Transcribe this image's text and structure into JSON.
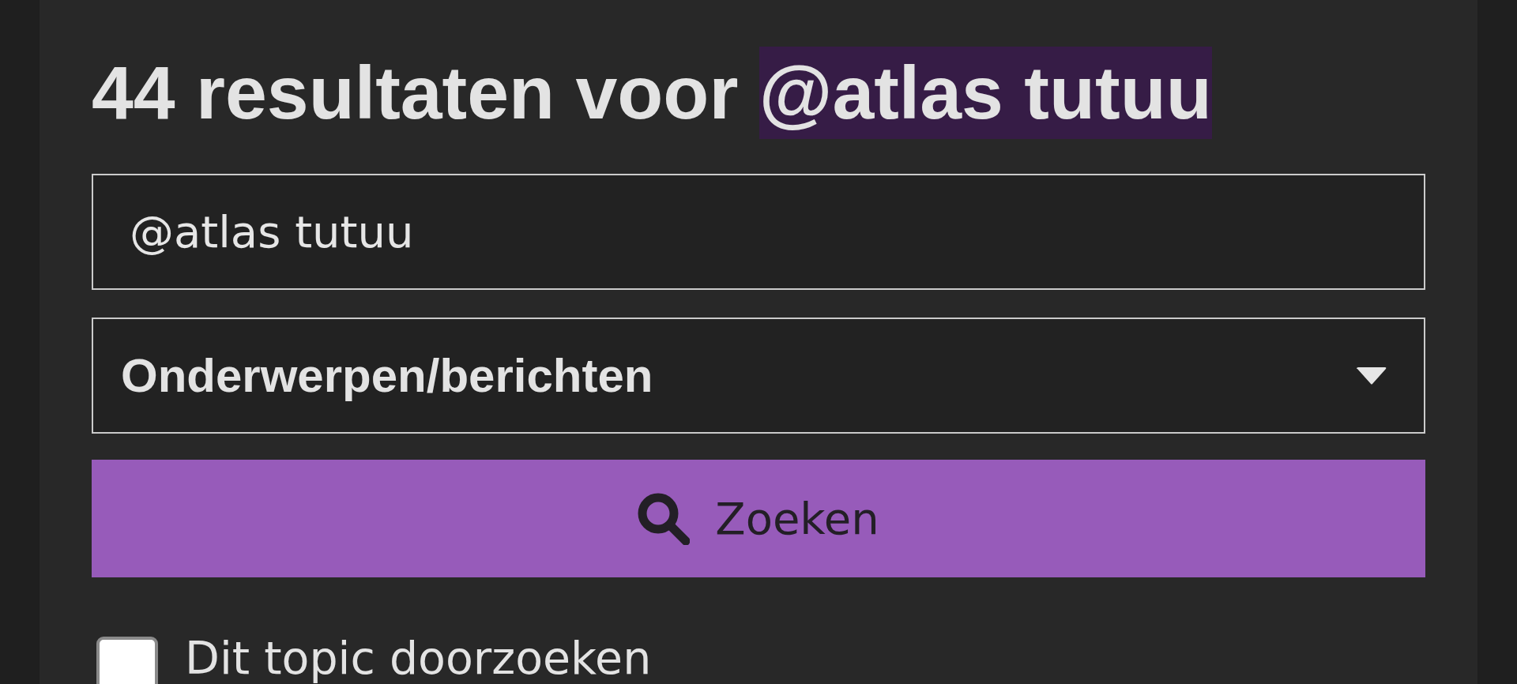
{
  "heading": {
    "text": "44 resultaten voor",
    "query": "@atlas tutuu"
  },
  "search_field": {
    "value": "@atlas tutuu"
  },
  "scope_select": {
    "value": "Onderwerpen/berichten"
  },
  "search_button": {
    "label": "Zoeken"
  },
  "options": [
    {
      "kind": "checkbox",
      "label": "Dit topic doorzoeken",
      "checked": false
    }
  ]
}
